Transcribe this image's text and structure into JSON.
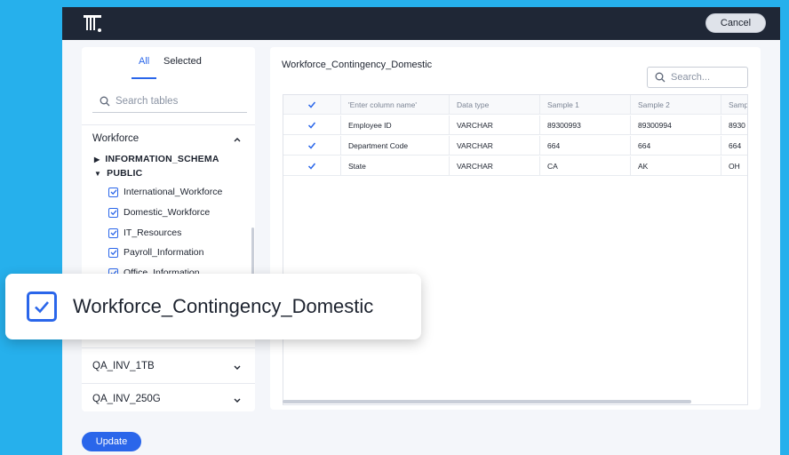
{
  "header": {
    "cancel_label": "Cancel",
    "logo_icon": "thoughtspot-logo"
  },
  "sidebar": {
    "tabs": [
      {
        "label": "All",
        "active": true
      },
      {
        "label": "Selected",
        "active": false
      }
    ],
    "search_placeholder": "Search tables",
    "connections": [
      {
        "name": "Workforce",
        "expanded": true,
        "schemas": [
          {
            "name": "INFORMATION_SCHEMA",
            "expanded": false,
            "tables": []
          },
          {
            "name": "PUBLIC",
            "expanded": true,
            "tables": [
              {
                "name": "International_Workforce",
                "checked": true
              },
              {
                "name": "Domestic_Workforce",
                "checked": true
              },
              {
                "name": "IT_Resources",
                "checked": true
              },
              {
                "name": "Payroll_Information",
                "checked": true
              },
              {
                "name": "Office_Information",
                "checked": true
              }
            ]
          }
        ]
      },
      {
        "name": "QA_INV_1TB",
        "expanded": false
      },
      {
        "name": "QA_INV_250G",
        "expanded": false
      }
    ]
  },
  "main": {
    "table_title": "Workforce_Contingency_Domestic",
    "search_placeholder": "Search...",
    "columns": [
      "'Enter column name'",
      "Data type",
      "Sample 1",
      "Sample 2",
      "Samp"
    ],
    "rows": [
      {
        "checked": true,
        "cells": [
          "Employee ID",
          "VARCHAR",
          "89300993",
          "89300994",
          "8930"
        ]
      },
      {
        "checked": true,
        "cells": [
          "Department Code",
          "VARCHAR",
          "664",
          "664",
          "664"
        ]
      },
      {
        "checked": true,
        "cells": [
          "State",
          "VARCHAR",
          "CA",
          "AK",
          "OH"
        ]
      }
    ]
  },
  "footer": {
    "update_label": "Update"
  },
  "callout": {
    "label": "Workforce_Contingency_Domestic",
    "checked": true
  },
  "colors": {
    "accent": "#2a66ea",
    "topbar": "#1f2736",
    "background": "#26b0ec"
  }
}
